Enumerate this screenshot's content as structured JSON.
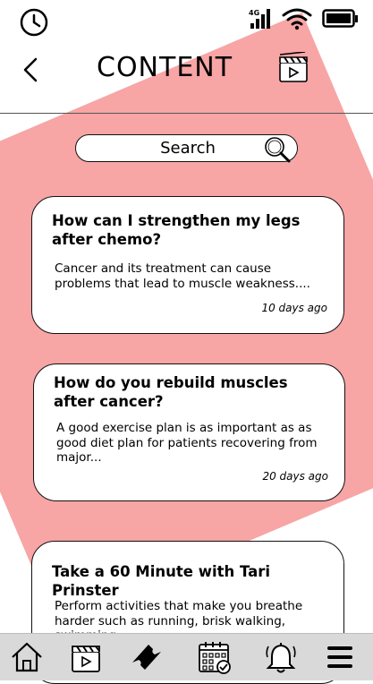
{
  "header": {
    "title": "CONTENT"
  },
  "search": {
    "placeholder": "Search"
  },
  "cards": [
    {
      "title": "How can I strengthen my legs after chemo?",
      "description": "Cancer and its treatment can cause problems that lead to muscle weakness....",
      "time": "10 days ago"
    },
    {
      "title": "How do you rebuild muscles after cancer?",
      "description": "A good exercise plan is as important as as good diet plan for patients recovering from major...",
      "time": "20 days ago"
    },
    {
      "title": "Take a 60 Minute with Tari Prinster",
      "description": "Perform activities that make you breathe harder such as running, brisk walking, swimming..."
    }
  ],
  "status": {
    "signal_label": "4G"
  },
  "colors": {
    "accent_shape": "#f7a5a5",
    "nav_bar": "#d9d9d9"
  }
}
